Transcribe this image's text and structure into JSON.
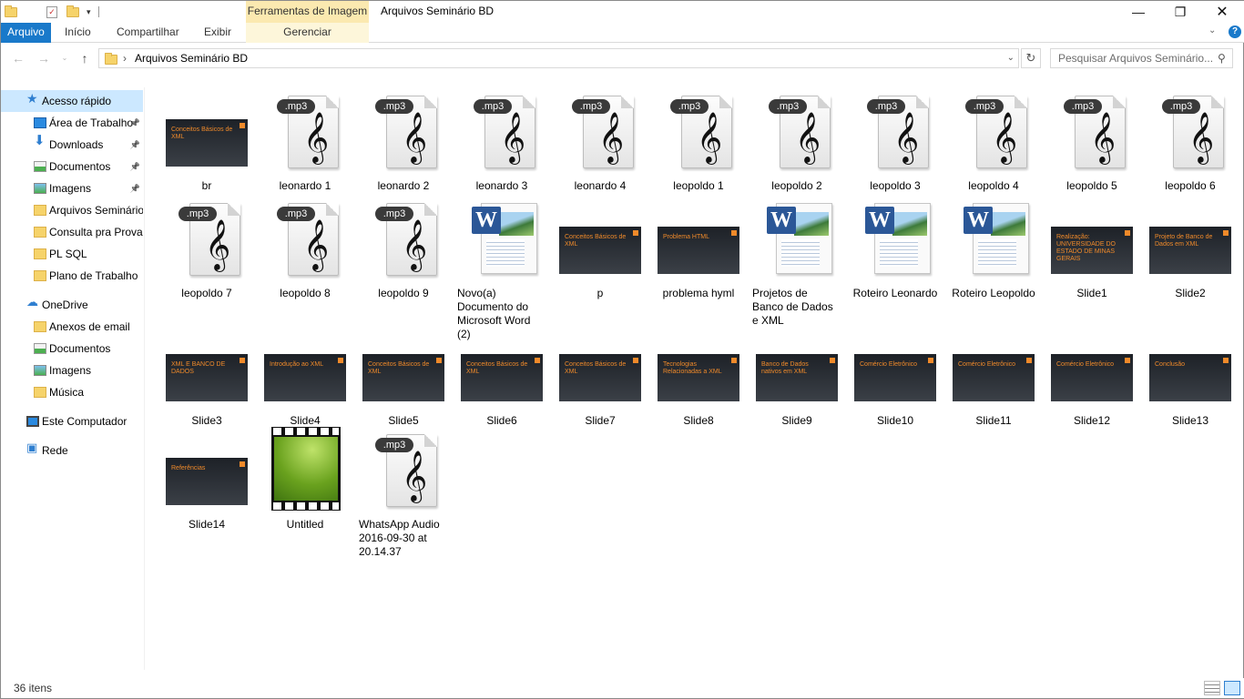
{
  "window": {
    "title": "Arquivos Seminário BD",
    "context_tab_group": "Ferramentas de Imagem"
  },
  "ribbon": {
    "tabs": [
      "Arquivo",
      "Início",
      "Compartilhar",
      "Exibir",
      "Gerenciar"
    ]
  },
  "address": {
    "path": "Arquivos Seminário BD",
    "search_placeholder": "Pesquisar Arquivos Seminário..."
  },
  "sidebar": {
    "items": [
      {
        "label": "Acesso rápido",
        "icon": "star-icon",
        "pinned": false,
        "selected": true
      },
      {
        "label": "Área de Trabalho",
        "icon": "desktop-icon",
        "pinned": true
      },
      {
        "label": "Downloads",
        "icon": "download-arrow-icon",
        "pinned": true
      },
      {
        "label": "Documentos",
        "icon": "documents-icon",
        "pinned": true
      },
      {
        "label": "Imagens",
        "icon": "pictures-icon",
        "pinned": true
      },
      {
        "label": "Arquivos Seminário BD",
        "icon": "folder-icon",
        "pinned": false
      },
      {
        "label": "Consulta pra Prova",
        "icon": "folder-icon",
        "pinned": false
      },
      {
        "label": "PL SQL",
        "icon": "folder-icon",
        "pinned": false
      },
      {
        "label": "Plano de Trabalho",
        "icon": "folder-icon",
        "pinned": false
      },
      {
        "label": "OneDrive",
        "icon": "cloud-icon",
        "pinned": false
      },
      {
        "label": "Anexos de email",
        "icon": "folder-icon",
        "pinned": false
      },
      {
        "label": "Documentos",
        "icon": "documents-icon",
        "pinned": false
      },
      {
        "label": "Imagens",
        "icon": "pictures-icon",
        "pinned": false
      },
      {
        "label": "Música",
        "icon": "folder-icon",
        "pinned": false
      },
      {
        "label": "Este Computador",
        "icon": "computer-icon",
        "pinned": false
      },
      {
        "label": "Rede",
        "icon": "network-icon",
        "pinned": false
      }
    ]
  },
  "files": [
    {
      "name": "br",
      "type": "slide",
      "title": "Conceitos Básicos de XML"
    },
    {
      "name": "leonardo 1",
      "type": "mp3"
    },
    {
      "name": "leonardo 2",
      "type": "mp3"
    },
    {
      "name": "leonardo 3",
      "type": "mp3"
    },
    {
      "name": "leonardo 4",
      "type": "mp3"
    },
    {
      "name": "leopoldo 1",
      "type": "mp3"
    },
    {
      "name": "leopoldo 2",
      "type": "mp3"
    },
    {
      "name": "leopoldo 3",
      "type": "mp3"
    },
    {
      "name": "leopoldo 4",
      "type": "mp3"
    },
    {
      "name": "leopoldo 5",
      "type": "mp3"
    },
    {
      "name": "leopoldo 6",
      "type": "mp3"
    },
    {
      "name": "leopoldo 7",
      "type": "mp3"
    },
    {
      "name": "leopoldo 8",
      "type": "mp3"
    },
    {
      "name": "leopoldo 9",
      "type": "mp3"
    },
    {
      "name": "Novo(a) Documento do Microsoft Word (2)",
      "type": "word"
    },
    {
      "name": "p",
      "type": "slide",
      "title": "Conceitos Básicos de XML"
    },
    {
      "name": "problema hyml",
      "type": "slide",
      "title": "Problema HTML"
    },
    {
      "name": "Projetos de Banco de Dados e XML",
      "type": "word"
    },
    {
      "name": "Roteiro Leonardo",
      "type": "word"
    },
    {
      "name": "Roteiro Leopoldo",
      "type": "word"
    },
    {
      "name": "Slide1",
      "type": "slide",
      "title": "Realização: UNIVERSIDADE DO ESTADO DE MINAS GERAIS"
    },
    {
      "name": "Slide2",
      "type": "slide",
      "title": "Projeto de Banco de Dados em XML"
    },
    {
      "name": "Slide3",
      "type": "slide",
      "title": "XML E BANCO DE DADOS"
    },
    {
      "name": "Slide4",
      "type": "slide",
      "title": "Introdução ao XML"
    },
    {
      "name": "Slide5",
      "type": "slide",
      "title": "Conceitos Básicos de XML"
    },
    {
      "name": "Slide6",
      "type": "slide",
      "title": "Conceitos Básicos de XML"
    },
    {
      "name": "Slide7",
      "type": "slide",
      "title": "Conceitos Básicos de XML"
    },
    {
      "name": "Slide8",
      "type": "slide",
      "title": "Tecnologias Relacionadas a XML"
    },
    {
      "name": "Slide9",
      "type": "slide",
      "title": "Banco de Dados nativos em XML"
    },
    {
      "name": "Slide10",
      "type": "slide",
      "title": "Comércio Eletrônico"
    },
    {
      "name": "Slide11",
      "type": "slide",
      "title": "Comércio Eletrônico"
    },
    {
      "name": "Slide12",
      "type": "slide",
      "title": "Comércio Eletrônico"
    },
    {
      "name": "Slide13",
      "type": "slide",
      "title": "Conclusão"
    },
    {
      "name": "Slide14",
      "type": "slide",
      "title": "Referências"
    },
    {
      "name": "Untitled",
      "type": "video"
    },
    {
      "name": "WhatsApp Audio 2016-09-30 at 20.14.37",
      "type": "mp3"
    }
  ],
  "status": {
    "item_count": "36 itens"
  },
  "colors": {
    "accent": "#1979ca",
    "selection": "#cce8ff",
    "slide_accent": "#f08a2a"
  }
}
